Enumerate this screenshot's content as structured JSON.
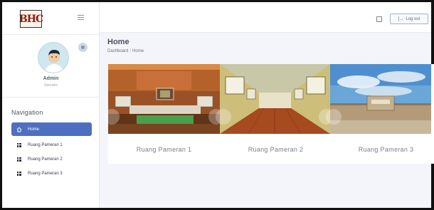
{
  "brand": {
    "logo_text": "BHC"
  },
  "profile": {
    "name": "Admin",
    "role": "Operator"
  },
  "navigation": {
    "title": "Navigation",
    "items": [
      {
        "label": "Home",
        "icon": "home-icon",
        "active": true
      },
      {
        "label": "Ruang Pameran 1",
        "icon": "grid-icon",
        "active": false
      },
      {
        "label": "Ruang Pameran 2",
        "icon": "grid-icon",
        "active": false
      },
      {
        "label": "Ruang Pameran 3",
        "icon": "grid-icon",
        "active": false
      }
    ]
  },
  "topbar": {
    "logout_label": "Log out"
  },
  "page": {
    "title": "Home",
    "breadcrumb": [
      "Dashboard",
      "Home"
    ]
  },
  "cards": [
    {
      "label": "Ruang Pameran 1"
    },
    {
      "label": "Ruang Pameran 2"
    },
    {
      "label": "Ruang Pameran 3"
    }
  ],
  "colors": {
    "accent": "#4e6fbf",
    "main_bg": "#f4f5fa",
    "text_muted": "#7a7f92"
  }
}
